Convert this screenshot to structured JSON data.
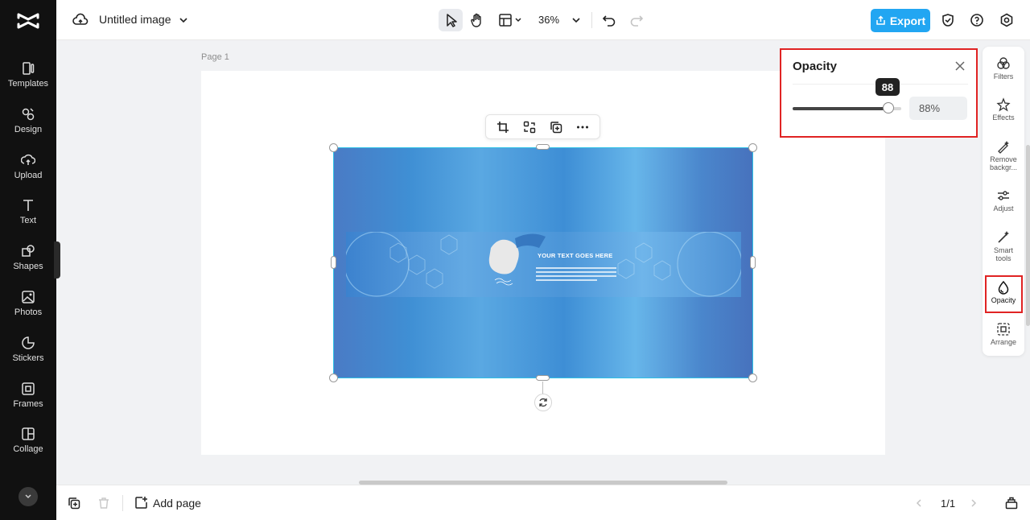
{
  "sidebar": {
    "items": [
      {
        "label": "Templates",
        "icon": "templates-icon"
      },
      {
        "label": "Design",
        "icon": "design-icon"
      },
      {
        "label": "Upload",
        "icon": "upload-icon"
      },
      {
        "label": "Text",
        "icon": "text-icon"
      },
      {
        "label": "Shapes",
        "icon": "shapes-icon"
      },
      {
        "label": "Photos",
        "icon": "photos-icon"
      },
      {
        "label": "Stickers",
        "icon": "stickers-icon"
      },
      {
        "label": "Frames",
        "icon": "frames-icon"
      },
      {
        "label": "Collage",
        "icon": "collage-icon"
      }
    ]
  },
  "topbar": {
    "title": "Untitled image",
    "zoom": "36%",
    "export_label": "Export"
  },
  "canvas": {
    "page_label": "Page 1",
    "banner_text": "YOUR TEXT GOES HERE"
  },
  "opacity_panel": {
    "title": "Opacity",
    "tooltip": "88",
    "value": 88,
    "input_value": "88%"
  },
  "right_panel": {
    "items": [
      {
        "label": "Filters",
        "icon": "filters-icon"
      },
      {
        "label": "Effects",
        "icon": "effects-icon"
      },
      {
        "label": "Remove backgr...",
        "icon": "remove-background-icon"
      },
      {
        "label": "Adjust",
        "icon": "adjust-icon"
      },
      {
        "label": "Smart tools",
        "icon": "smart-tools-icon"
      },
      {
        "label": "Opacity",
        "icon": "opacity-icon"
      },
      {
        "label": "Arrange",
        "icon": "arrange-icon"
      }
    ]
  },
  "bottombar": {
    "add_page_label": "Add page",
    "page_count": "1/1"
  },
  "colors": {
    "accent": "#22a6f2",
    "highlight": "#e02323",
    "sidebar_bg": "#111111"
  }
}
